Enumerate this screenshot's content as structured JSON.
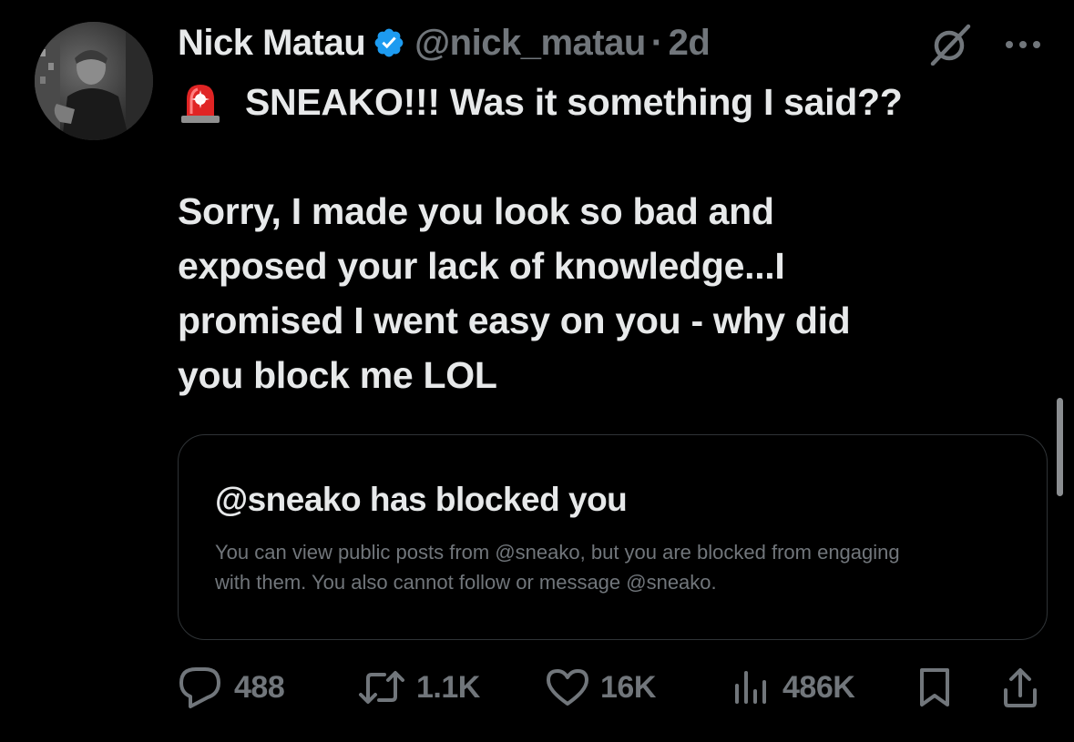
{
  "author": {
    "display_name": "Nick Matau",
    "handle": "@nick_matau",
    "separator": "·",
    "time": "2d"
  },
  "tweet": {
    "line1": "SNEAKO!!! Was it something I said??",
    "paragraph2": [
      "Sorry, I made you look so bad and",
      "exposed your lack of knowledge...I",
      "promised I went easy on you - why did",
      "you block me LOL"
    ]
  },
  "blocked_card": {
    "title": "@sneako has blocked you",
    "description_lines": [
      "You can view public posts from @sneako, but you are blocked from engaging",
      "with them. You also cannot follow or message @sneako."
    ]
  },
  "actions": {
    "replies": "488",
    "reposts": "1.1K",
    "likes": "16K",
    "views": "486K"
  },
  "colors": {
    "background": "#000000",
    "primary_text": "#e7e9ea",
    "secondary_text": "#71767b",
    "verified_badge": "#1d9bf0",
    "card_border": "#2f3336"
  },
  "icons": {
    "verified": "verified-badge-icon",
    "grok": "grok-icon",
    "more": "more-icon",
    "siren": "siren-emoji-icon",
    "reply": "reply-icon",
    "repost": "repost-icon",
    "like": "heart-icon",
    "views": "views-icon",
    "bookmark": "bookmark-icon",
    "share": "share-icon"
  }
}
